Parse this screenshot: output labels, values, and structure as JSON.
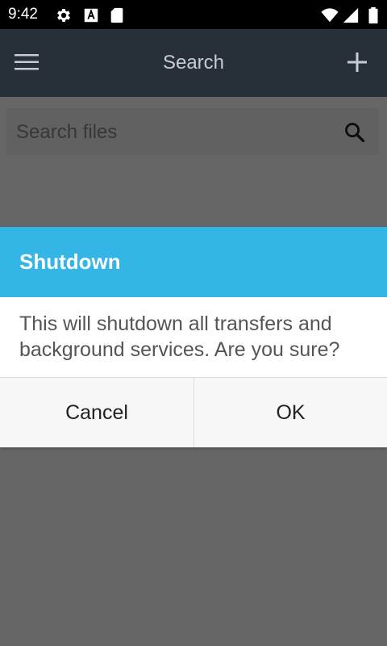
{
  "status_bar": {
    "time": "9:42",
    "icons": [
      "gear-icon",
      "font-a-icon",
      "sd-card-icon",
      "wifi-icon",
      "cell-signal-icon",
      "battery-icon"
    ]
  },
  "app_bar": {
    "title": "Search",
    "menu_icon": "hamburger-menu-icon",
    "add_icon": "plus-icon",
    "background": "#273038"
  },
  "search": {
    "placeholder": "Search files",
    "value": "",
    "icon": "magnifier-icon"
  },
  "dialog": {
    "title": "Shutdown",
    "message": "This will shutdown all transfers and background services. Are you sure?",
    "cancel_label": "Cancel",
    "ok_label": "OK",
    "header_color": "#33b5e5"
  }
}
